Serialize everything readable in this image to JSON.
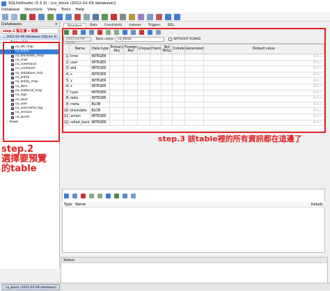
{
  "window": {
    "title": "SQLiteStudio (3.3.3) - [co_block (2022-02-09 database)]"
  },
  "menu": [
    "Database",
    "Structure",
    "View",
    "Tools",
    "Help"
  ],
  "left_panel": {
    "header": "Databases",
    "filter_text": "step.1 點左邊 ▾ 展開",
    "db_node": "2022-02-09 database (SQLite 3)",
    "tables_node": "Tables (16)",
    "tables": [
      "co_att_map",
      "co_block",
      "co_blocklabs_map",
      "co_chat",
      "co_command",
      "co_container",
      "co_database_lock",
      "co_entity",
      "co_entity_map",
      "co_item",
      "co_material_map",
      "co_sign",
      "co_skull",
      "co_user",
      "co_username_log",
      "co_version",
      "co_world"
    ],
    "selected_table": "co_block",
    "views_node": "Views"
  },
  "annotations": {
    "step2": [
      "step.2",
      "選擇要預覽",
      "的table"
    ],
    "step3": "step.3 該table裡的所有資訊都在這邊了"
  },
  "editor": {
    "tabs": [
      "Structure",
      "Data",
      "Constraints",
      "Indexes",
      "Triggers",
      "DDL"
    ],
    "active_tab": "Structure",
    "db_combo": "2022-02-09 datab",
    "table_name_label": "Table name:",
    "table_name": "co_block",
    "without_rowid": "WITHOUT ROWID",
    "columns_header": [
      "",
      "Name",
      "Data type",
      "Primary Key",
      "Foreign Key",
      "Unique",
      "Check",
      "Not NULL",
      "Collate",
      "Generated",
      "Default value"
    ],
    "rows": [
      [
        "1",
        "time",
        "INTEGER",
        "NULL"
      ],
      [
        "2",
        "user",
        "INTEGER",
        "NULL"
      ],
      [
        "3",
        "wid",
        "INTEGER",
        "NULL"
      ],
      [
        "4",
        "x",
        "INTEGER",
        "NULL"
      ],
      [
        "5",
        "y",
        "INTEGER",
        "NULL"
      ],
      [
        "6",
        "z",
        "INTEGER",
        "NULL"
      ],
      [
        "7",
        "type",
        "INTEGER",
        "NULL"
      ],
      [
        "8",
        "data",
        "INTEGER",
        "NULL"
      ],
      [
        "9",
        "meta",
        "BLOB",
        "NULL"
      ],
      [
        "10",
        "blockdata",
        "BLOB",
        "NULL"
      ],
      [
        "11",
        "action",
        "INTEGER",
        "NULL"
      ],
      [
        "12",
        "rolled_back",
        "INTEGER",
        "NULL"
      ]
    ]
  },
  "bottom_pane": {
    "col_type": "Type",
    "col_name": "Name",
    "col_details": "Details"
  },
  "status": {
    "header": "Status"
  },
  "taskbar": {
    "item": "co_block (2022-02-09 database)"
  },
  "colors": {
    "annotation_red": "#e02020",
    "selection_blue": "#3b7dd8"
  }
}
